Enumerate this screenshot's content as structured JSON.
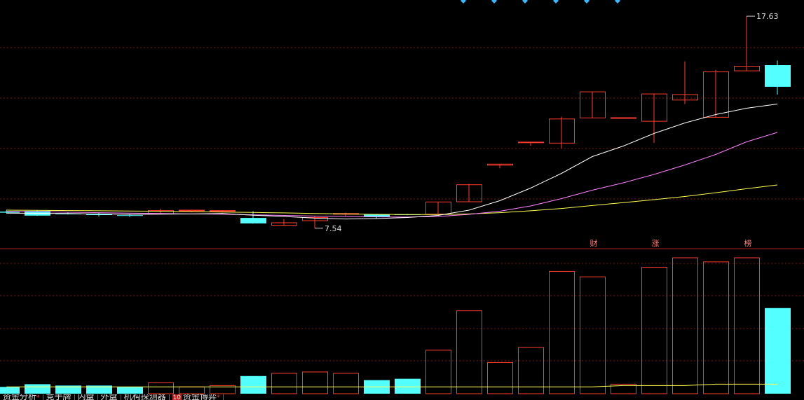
{
  "colors": {
    "background": "#000000",
    "up": "#ff3b30",
    "down": "#54ffff",
    "ma_white": "#ffffff",
    "ma_pink": "#ff80ff",
    "ma_yellow": "#ffff50",
    "grid": "#7a1a1a",
    "divider": "#aa2020"
  },
  "chart_data": {
    "type": "candlestick",
    "price_ylim": [
      6.9,
      18.4
    ],
    "volume_ylim": [
      0,
      100
    ],
    "annotations": {
      "high_label": "17.63",
      "low_label": "7.54"
    },
    "markers": [
      "财",
      "涨",
      "榜"
    ],
    "candles": [
      {
        "o": 8.33,
        "h": 8.38,
        "l": 8.27,
        "c": 8.28
      },
      {
        "o": 8.36,
        "h": 8.4,
        "l": 8.13,
        "c": 8.14
      },
      {
        "o": 8.24,
        "h": 8.3,
        "l": 8.19,
        "c": 8.23
      },
      {
        "o": 8.2,
        "h": 8.29,
        "l": 8.1,
        "c": 8.19
      },
      {
        "o": 8.16,
        "h": 8.2,
        "l": 8.08,
        "c": 8.13
      },
      {
        "o": 8.22,
        "h": 8.47,
        "l": 8.2,
        "c": 8.38
      },
      {
        "o": 8.37,
        "h": 8.42,
        "l": 8.3,
        "c": 8.4
      },
      {
        "o": 8.35,
        "h": 8.4,
        "l": 8.3,
        "c": 8.38
      },
      {
        "o": 8.03,
        "h": 8.35,
        "l": 7.76,
        "c": 7.77
      },
      {
        "o": 7.68,
        "h": 7.97,
        "l": 7.66,
        "c": 7.8
      },
      {
        "o": 7.9,
        "h": 8.13,
        "l": 7.54,
        "c": 8.05
      },
      {
        "o": 8.22,
        "h": 8.28,
        "l": 8.1,
        "c": 8.24
      },
      {
        "o": 8.19,
        "h": 8.22,
        "l": 8.02,
        "c": 8.08
      },
      {
        "o": 8.2,
        "h": 8.22,
        "l": 8.16,
        "c": 8.19
      },
      {
        "o": 8.21,
        "h": 8.8,
        "l": 8.2,
        "c": 8.79
      },
      {
        "o": 8.8,
        "h": 9.65,
        "l": 8.8,
        "c": 9.61
      },
      {
        "o": 10.54,
        "h": 10.59,
        "l": 10.39,
        "c": 10.59
      },
      {
        "o": 11.64,
        "h": 11.66,
        "l": 11.46,
        "c": 11.64
      },
      {
        "o": 11.59,
        "h": 12.85,
        "l": 11.34,
        "c": 12.74
      },
      {
        "o": 12.79,
        "h": 14.03,
        "l": 12.79,
        "c": 14.03
      },
      {
        "o": 12.8,
        "h": 12.8,
        "l": 12.8,
        "c": 12.8
      },
      {
        "o": 12.63,
        "h": 13.95,
        "l": 11.6,
        "c": 13.93
      },
      {
        "o": 13.64,
        "h": 15.48,
        "l": 13.45,
        "c": 13.9
      },
      {
        "o": 12.82,
        "h": 15.08,
        "l": 12.82,
        "c": 14.98
      },
      {
        "o": 15.03,
        "h": 17.63,
        "l": 15.03,
        "c": 15.25
      },
      {
        "o": 15.3,
        "h": 15.52,
        "l": 13.9,
        "c": 14.27
      }
    ],
    "volume": [
      5,
      7,
      6,
      6,
      5,
      8,
      5,
      6,
      13,
      15,
      16,
      15,
      10,
      11,
      32,
      61,
      23,
      34,
      90,
      86,
      7,
      93,
      100,
      97,
      100,
      63
    ],
    "ma_white": [
      8.26,
      8.25,
      8.24,
      8.22,
      8.2,
      8.21,
      8.22,
      8.24,
      8.16,
      8.1,
      8.02,
      7.98,
      8.0,
      8.05,
      8.15,
      8.4,
      8.85,
      9.45,
      10.15,
      10.95,
      11.45,
      12.05,
      12.55,
      12.95,
      13.25,
      13.45
    ],
    "ma_pink": [
      8.34,
      8.32,
      8.3,
      8.28,
      8.26,
      8.24,
      8.22,
      8.21,
      8.18,
      8.15,
      8.12,
      8.1,
      8.08,
      8.07,
      8.1,
      8.2,
      8.35,
      8.6,
      8.95,
      9.35,
      9.7,
      10.1,
      10.55,
      11.05,
      11.65,
      12.1
    ],
    "ma_yellow": [
      8.4,
      8.39,
      8.38,
      8.37,
      8.36,
      8.35,
      8.33,
      8.31,
      8.29,
      8.27,
      8.24,
      8.22,
      8.2,
      8.19,
      8.19,
      8.22,
      8.28,
      8.37,
      8.48,
      8.62,
      8.76,
      8.9,
      9.05,
      9.23,
      9.42,
      9.6
    ],
    "vol_ma": [
      5,
      5,
      5,
      5,
      5,
      5,
      5,
      5,
      5,
      5,
      5,
      5,
      5,
      5,
      5,
      5,
      5,
      5,
      5,
      5,
      6,
      6,
      6,
      7,
      7,
      7
    ]
  },
  "tabs": [
    {
      "label": "资金分析",
      "badge": "",
      "dot": "*"
    },
    {
      "label": "竞手牌",
      "badge": "",
      "dot": ""
    },
    {
      "label": "内盘",
      "badge": "",
      "dot": ""
    },
    {
      "label": "外盘",
      "badge": "",
      "dot": ""
    },
    {
      "label": "机构探测器",
      "badge": "",
      "dot": ""
    },
    {
      "label": "资金博弈",
      "badge": "10",
      "dot": "*"
    }
  ]
}
